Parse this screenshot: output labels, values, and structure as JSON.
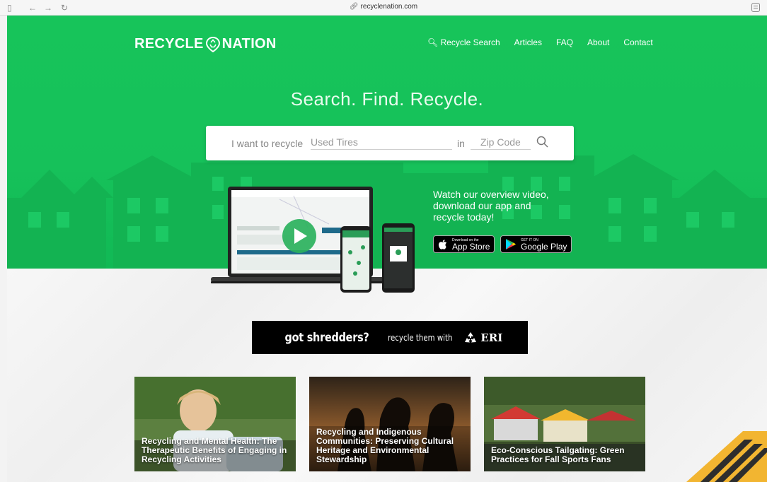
{
  "browser": {
    "url": "recyclenation.com"
  },
  "site": {
    "logo_left": "RECYCLE",
    "logo_right": "NATION"
  },
  "nav": {
    "search": "Recycle Search",
    "articles": "Articles",
    "faq": "FAQ",
    "about": "About",
    "contact": "Contact"
  },
  "hero": {
    "headline": "Search.  Find.  Recycle.",
    "search_lead": "I want to recycle",
    "search_item_placeholder": "Used Tires",
    "search_in": "in",
    "search_zip_placeholder": "Zip Code"
  },
  "promo": {
    "line1": "Watch our overview video,",
    "line2": "download our app and",
    "line3": "recycle today!",
    "appstore_small": "Download on the",
    "appstore_large": "App Store",
    "googleplay_small": "GET IT ON",
    "googleplay_large": "Google Play"
  },
  "ad_banner": {
    "big": "got shredders?",
    "small": "recycle them with",
    "brand": "ERI"
  },
  "articles": [
    {
      "title": "Recycling and Mental Health: The Therapeutic Benefits of Engaging in Recycling Activities"
    },
    {
      "title": "Recycling and Indigenous Communities: Preserving Cultural Heritage and Environmental Stewardship"
    },
    {
      "title": "Eco-Conscious Tailgating: Green Practices for Fall Sports Fans"
    }
  ],
  "colors": {
    "brand_green": "#16c15a",
    "banner_black": "#000000"
  }
}
